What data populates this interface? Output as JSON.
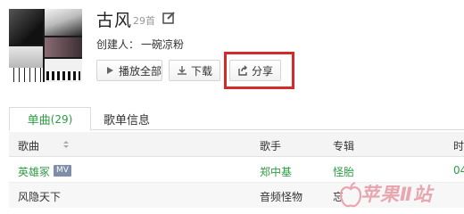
{
  "playlist": {
    "title": "古风",
    "song_count": "29首",
    "creator_label": "创建人：",
    "creator_name": "一碗凉粉"
  },
  "actions": {
    "play_all": "播放全部",
    "download": "下载",
    "share": "分享"
  },
  "tabs": [
    {
      "label": "单曲",
      "count": "(29)"
    },
    {
      "label": "歌单信息"
    }
  ],
  "table": {
    "columns": [
      "歌曲",
      "歌手",
      "专辑",
      "时"
    ],
    "rows": [
      {
        "song": "英雄冢",
        "badge": "MV",
        "artist": "郑中基",
        "album": "怪胎",
        "time": "04"
      },
      {
        "song": "风隐天下",
        "artist": "音频怪物",
        "album": "忘"
      }
    ]
  },
  "watermark": {
    "text": "苹果Ⅱ站"
  },
  "colors": {
    "accent_green": "#2f9c44",
    "highlight_red": "#d42a2a",
    "mv_badge": "#7f8ea8"
  },
  "icons": [
    "edit-icon",
    "play-icon",
    "download-icon",
    "share-icon",
    "sort-icon",
    "apple-logo"
  ]
}
